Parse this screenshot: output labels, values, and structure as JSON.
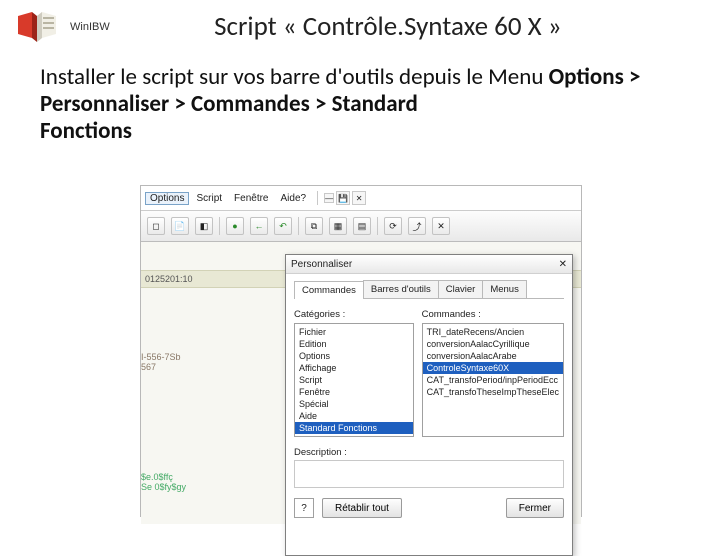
{
  "header": {
    "app_name": "WinIBW",
    "title": "Script « Contrôle.Syntaxe 60 X »"
  },
  "paragraph": {
    "line1": "Installer le script sur vos barre d'outils depuis le Menu ",
    "line2_bold_1": "Options > Personnaliser > Commandes > Standard",
    "line3_bold": "Fonctions"
  },
  "menubar": {
    "options": "Options",
    "script": "Script",
    "fenetre": "Fenêtre",
    "aide": "Aide?"
  },
  "toolbar_glyphs": {
    "g1": "◻",
    "g2": "📄",
    "g3": "◧",
    "g4": "●",
    "g5": "←",
    "g6": "↶",
    "g7": "⧉",
    "g8": "▦",
    "g9": "▤",
    "g10": "⟳",
    "g11": "⤴",
    "g12": "✕"
  },
  "bands": {
    "b1": "0125201:10"
  },
  "snips": {
    "s1a": "I-556-7Sb",
    "s1b": "567",
    "s2a": "$e.0$ffç",
    "s2b": "Se 0$fy$gy"
  },
  "dialog": {
    "title": "Personnaliser",
    "close": "✕",
    "tabs": {
      "commandes": "Commandes",
      "barres": "Barres d'outils",
      "clavier": "Clavier",
      "menus": "Menus"
    },
    "categories_label": "Catégories :",
    "categories": [
      "Fichier",
      "Edition",
      "Options",
      "Affichage",
      "Script",
      "Fenêtre",
      "Spécial",
      "Aide",
      "Standard Fonctions"
    ],
    "commands_label": "Commandes :",
    "commands": [
      "TRI_dateRecens/Ancien",
      "conversionAalacCyrillique",
      "conversionAalacArabe",
      "ControleSyntaxe60X",
      "CAT_transfoPeriod/inpPeriodEcc",
      "CAT_transfoTheseImpTheseElec"
    ],
    "selected_category_index": 8,
    "selected_command_index": 3,
    "description_label": "Description :",
    "qmark": "?",
    "retablir": "Rétablir tout",
    "fermer": "Fermer"
  },
  "icons": {
    "tb_dash": "—",
    "tb_disk": "💾",
    "tb_x": "✕"
  }
}
